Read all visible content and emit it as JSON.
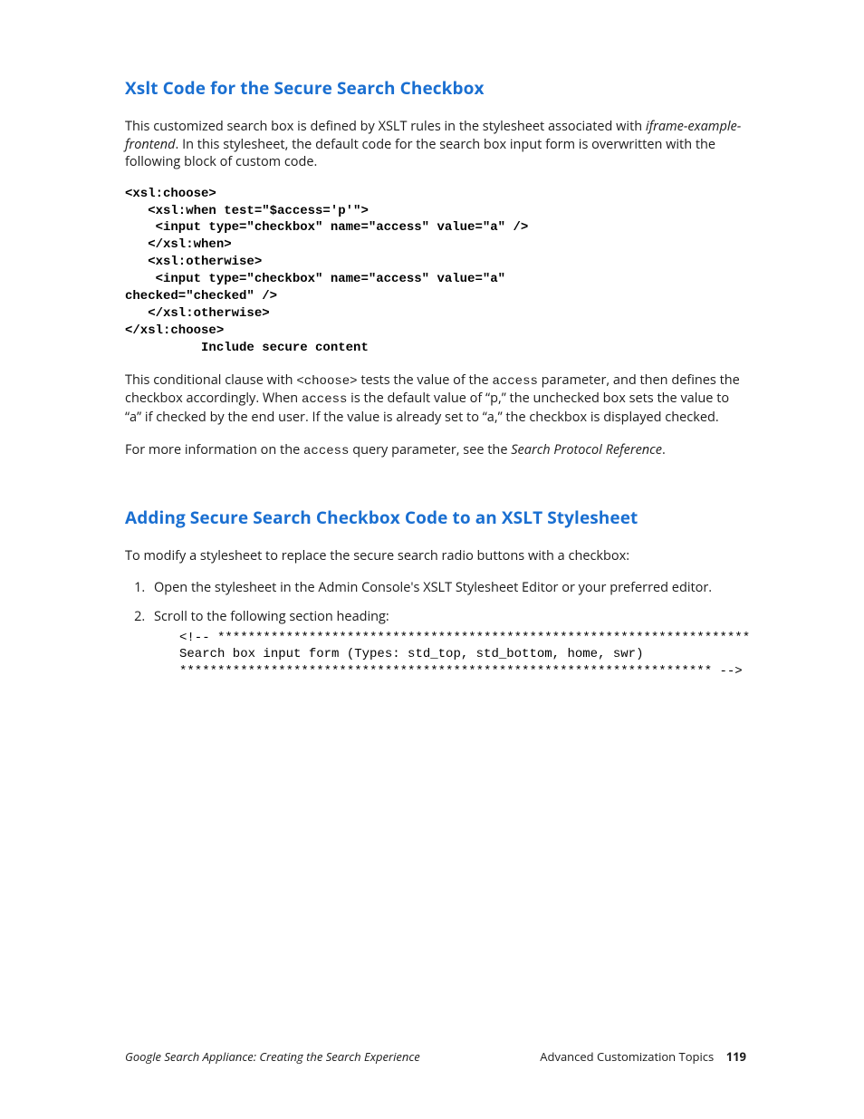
{
  "section1": {
    "heading": "Xslt Code for the Secure Search Checkbox",
    "para1_a": "This customized search box is defined by XSLT rules in the stylesheet associated with ",
    "para1_ital": "iframe-example-frontend",
    "para1_b": ". In this stylesheet, the default code for the search box input form is overwritten with the following block of custom code.",
    "code": "<xsl:choose>\n   <xsl:when test=\"$access='p'\">\n    <input type=\"checkbox\" name=\"access\" value=\"a\" />\n   </xsl:when>\n   <xsl:otherwise>\n    <input type=\"checkbox\" name=\"access\" value=\"a\"\nchecked=\"checked\" />\n   </xsl:otherwise>\n</xsl:choose>\n          Include secure content",
    "para2_a": "This conditional clause with ",
    "para2_code1": "<choose>",
    "para2_b": " tests the value of the ",
    "para2_code2": "access",
    "para2_c": " parameter, and then defines the checkbox accordingly. When ",
    "para2_code3": "access",
    "para2_d": " is the default value of “p,” the unchecked box sets the value to “a” if checked by the end user. If the value is already set to “a,” the checkbox is displayed checked.",
    "para3_a": "For more information on the ",
    "para3_code": "access",
    "para3_b": " query parameter, see the ",
    "para3_ital": "Search Protocol Reference",
    "para3_c": "."
  },
  "section2": {
    "heading": "Adding Secure Search Checkbox Code to an XSLT Stylesheet",
    "intro": "To modify a stylesheet to replace the secure search radio buttons with a checkbox:",
    "step1": "Open the stylesheet in the Admin Console's XSLT Stylesheet Editor or your preferred editor.",
    "step2": "Scroll to the following section heading:",
    "code": "<!-- **********************************************************************\nSearch box input form (Types: std_top, std_bottom, home, swr)\n********************************************************************** -->"
  },
  "footer": {
    "left": "Google Search Appliance: Creating the Search Experience",
    "right_label": "Advanced Customization Topics",
    "pageno": "119"
  }
}
